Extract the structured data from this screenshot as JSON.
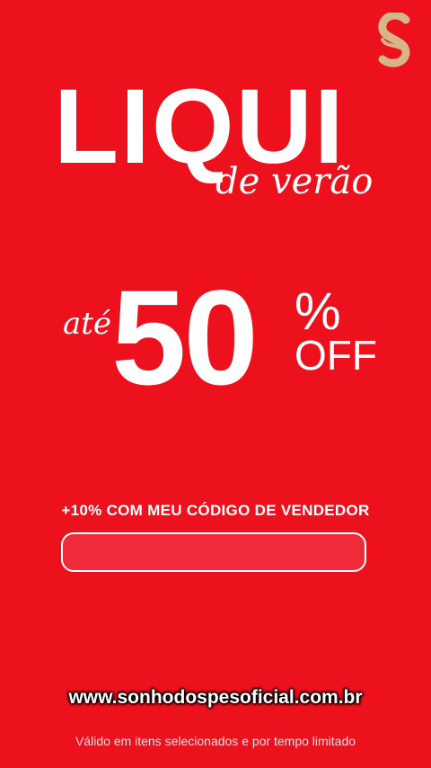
{
  "colors": {
    "background": "#ed111e",
    "text": "#ffffff",
    "logo_gold": "#d8b48a",
    "input_fill": "#f02b3a"
  },
  "logo": {
    "icon": "brand-s-logo-icon"
  },
  "promo": {
    "title": "LIQUI",
    "subtitle": "de verão",
    "discount_prefix": "até",
    "discount_value": "50",
    "discount_percent": "%",
    "discount_off": "OFF"
  },
  "seller_code": {
    "label": "+10% COM MEU CÓDIGO DE VENDEDOR",
    "value": ""
  },
  "footer": {
    "website": "www.sonhodospesoficial.com.br",
    "disclaimer": "Válido em itens selecionados e por tempo limitado"
  }
}
